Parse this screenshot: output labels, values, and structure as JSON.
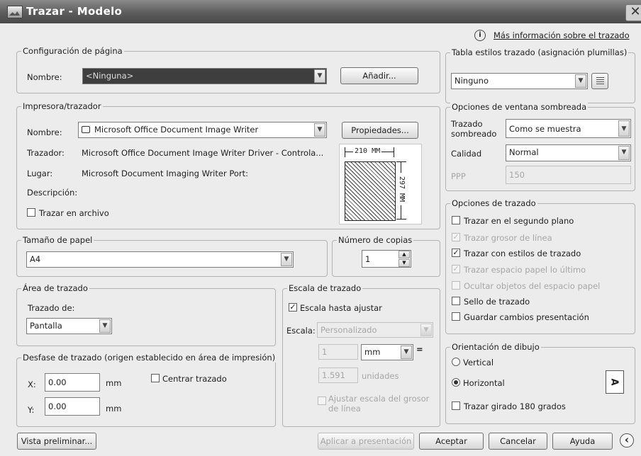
{
  "window": {
    "title": "Trazar - Modelo",
    "close_glyph": "✕"
  },
  "more_info": {
    "icon": "info-icon",
    "glyph": "i",
    "text": "Más información sobre el trazado"
  },
  "page_setup": {
    "legend": "Configuración de página",
    "name_label": "Nombre:",
    "name_value": "<Ninguna>",
    "add_button": "Añadir..."
  },
  "printer": {
    "legend": "Impresora/trazador",
    "name_label": "Nombre:",
    "name_value": "Microsoft Office Document Image Writer",
    "properties_button": "Propiedades...",
    "plotter_label": "Trazador:",
    "plotter_value": "Microsoft Office Document Image Writer Driver - Controla...",
    "location_label": "Lugar:",
    "location_value": "Microsoft Document Imaging Writer Port:",
    "description_label": "Descripción:",
    "plot_to_file": "Trazar en archivo",
    "paper_width": "210 MM",
    "paper_height": "297 MM"
  },
  "paper_size": {
    "legend": "Tamaño de papel",
    "value": "A4"
  },
  "copies": {
    "legend": "Número de copias",
    "value": "1"
  },
  "plot_area": {
    "legend": "Área de trazado",
    "what_label": "Trazado de:",
    "what_value": "Pantalla"
  },
  "plot_offset": {
    "legend": "Desfase de trazado (origen establecido en área de impresión)",
    "x_label": "X:",
    "x_value": "0.00",
    "x_unit": "mm",
    "y_label": "Y:",
    "y_value": "0.00",
    "y_unit": "mm",
    "center": "Centrar trazado"
  },
  "plot_scale": {
    "legend": "Escala de trazado",
    "fit": "Escala hasta ajustar",
    "scale_label": "Escala:",
    "scale_value": "Personalizado",
    "value1": "1",
    "unit1": "mm",
    "equals": "=",
    "value2": "1.591",
    "unit2": "unidades",
    "lineweights_line1": "Ajustar escala del grosor",
    "lineweights_line2": "de línea"
  },
  "style_table": {
    "legend": "Tabla estilos trazado (asignación plumillas)",
    "value": "Ninguno"
  },
  "shaded": {
    "legend": "Opciones de ventana sombreada",
    "shade_label_1": "Trazado",
    "shade_label_2": "sombreado",
    "shade_value": "Como se muestra",
    "quality_label": "Calidad",
    "quality_value": "Normal",
    "dpi_label": "PPP",
    "dpi_value": "150"
  },
  "options": {
    "legend": "Opciones de trazado",
    "items": [
      {
        "label": "Trazar en el segundo plano",
        "check": ""
      },
      {
        "label": "Trazar grosor de línea",
        "check": "✓"
      },
      {
        "label": "Trazar con estilos de trazado",
        "check": "✓"
      },
      {
        "label": "Trazar espacio papel lo último",
        "check": "✓"
      },
      {
        "label": "Ocultar objetos del espacio papel",
        "check": ""
      },
      {
        "label": "Sello de trazado",
        "check": ""
      },
      {
        "label": "Guardar cambios presentación",
        "check": ""
      }
    ]
  },
  "orientation": {
    "legend": "Orientación de dibujo",
    "portrait": "Vertical",
    "landscape": "Horizontal",
    "upside_down": "Trazar girado 180 grados",
    "preview_glyph": "A"
  },
  "footer": {
    "preview": "Vista preliminar...",
    "apply": "Aplicar a presentación",
    "ok": "Aceptar",
    "cancel": "Cancelar",
    "help": "Ayuda",
    "collapse_glyph": "‹"
  },
  "checks": {
    "fit": "✓"
  }
}
